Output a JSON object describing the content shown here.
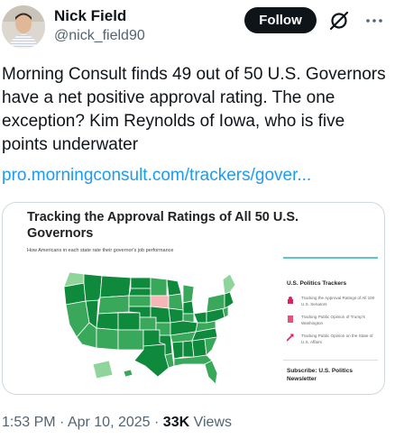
{
  "author": {
    "name": "Nick Field",
    "handle": "@nick_field90",
    "follow_label": "Follow"
  },
  "tweet": {
    "text": "Morning Consult finds 49 out of 50 U.S. Governors have a net positive approval rating. The one exception? Kim Reynolds of Iowa, who is five points underwater",
    "link": "pro.morningconsult.com/trackers/gover..."
  },
  "card": {
    "title": "Tracking the Approval Ratings of All 50 U.S. Governors",
    "subtitle": "How Americans in each state rate their governor's job performance",
    "sidebar": {
      "title": "U.S. Politics Trackers",
      "items": [
        {
          "label": "Tracking the Approval Ratings of All 100 U.S. Senators",
          "icon": "capitol-icon"
        },
        {
          "label": "Tracking Public Opinion of Trump's Washington",
          "icon": "portrait-icon"
        },
        {
          "label": "Tracking Public Opinion on the State of U.S. Affairs",
          "icon": "trend-arrow-icon"
        }
      ],
      "subscribe": "Subscribe: U.S. Politics Newsletter"
    },
    "colors": {
      "approve_dark": "#0f8a3c",
      "approve_mid": "#3aa85a",
      "approve_light": "#8fd49a",
      "underwater": "#f4b6b6"
    }
  },
  "meta": {
    "time": "1:53 PM",
    "date": "Apr 10, 2025",
    "views_count": "33K",
    "views_label": "Views",
    "separator": "·"
  }
}
